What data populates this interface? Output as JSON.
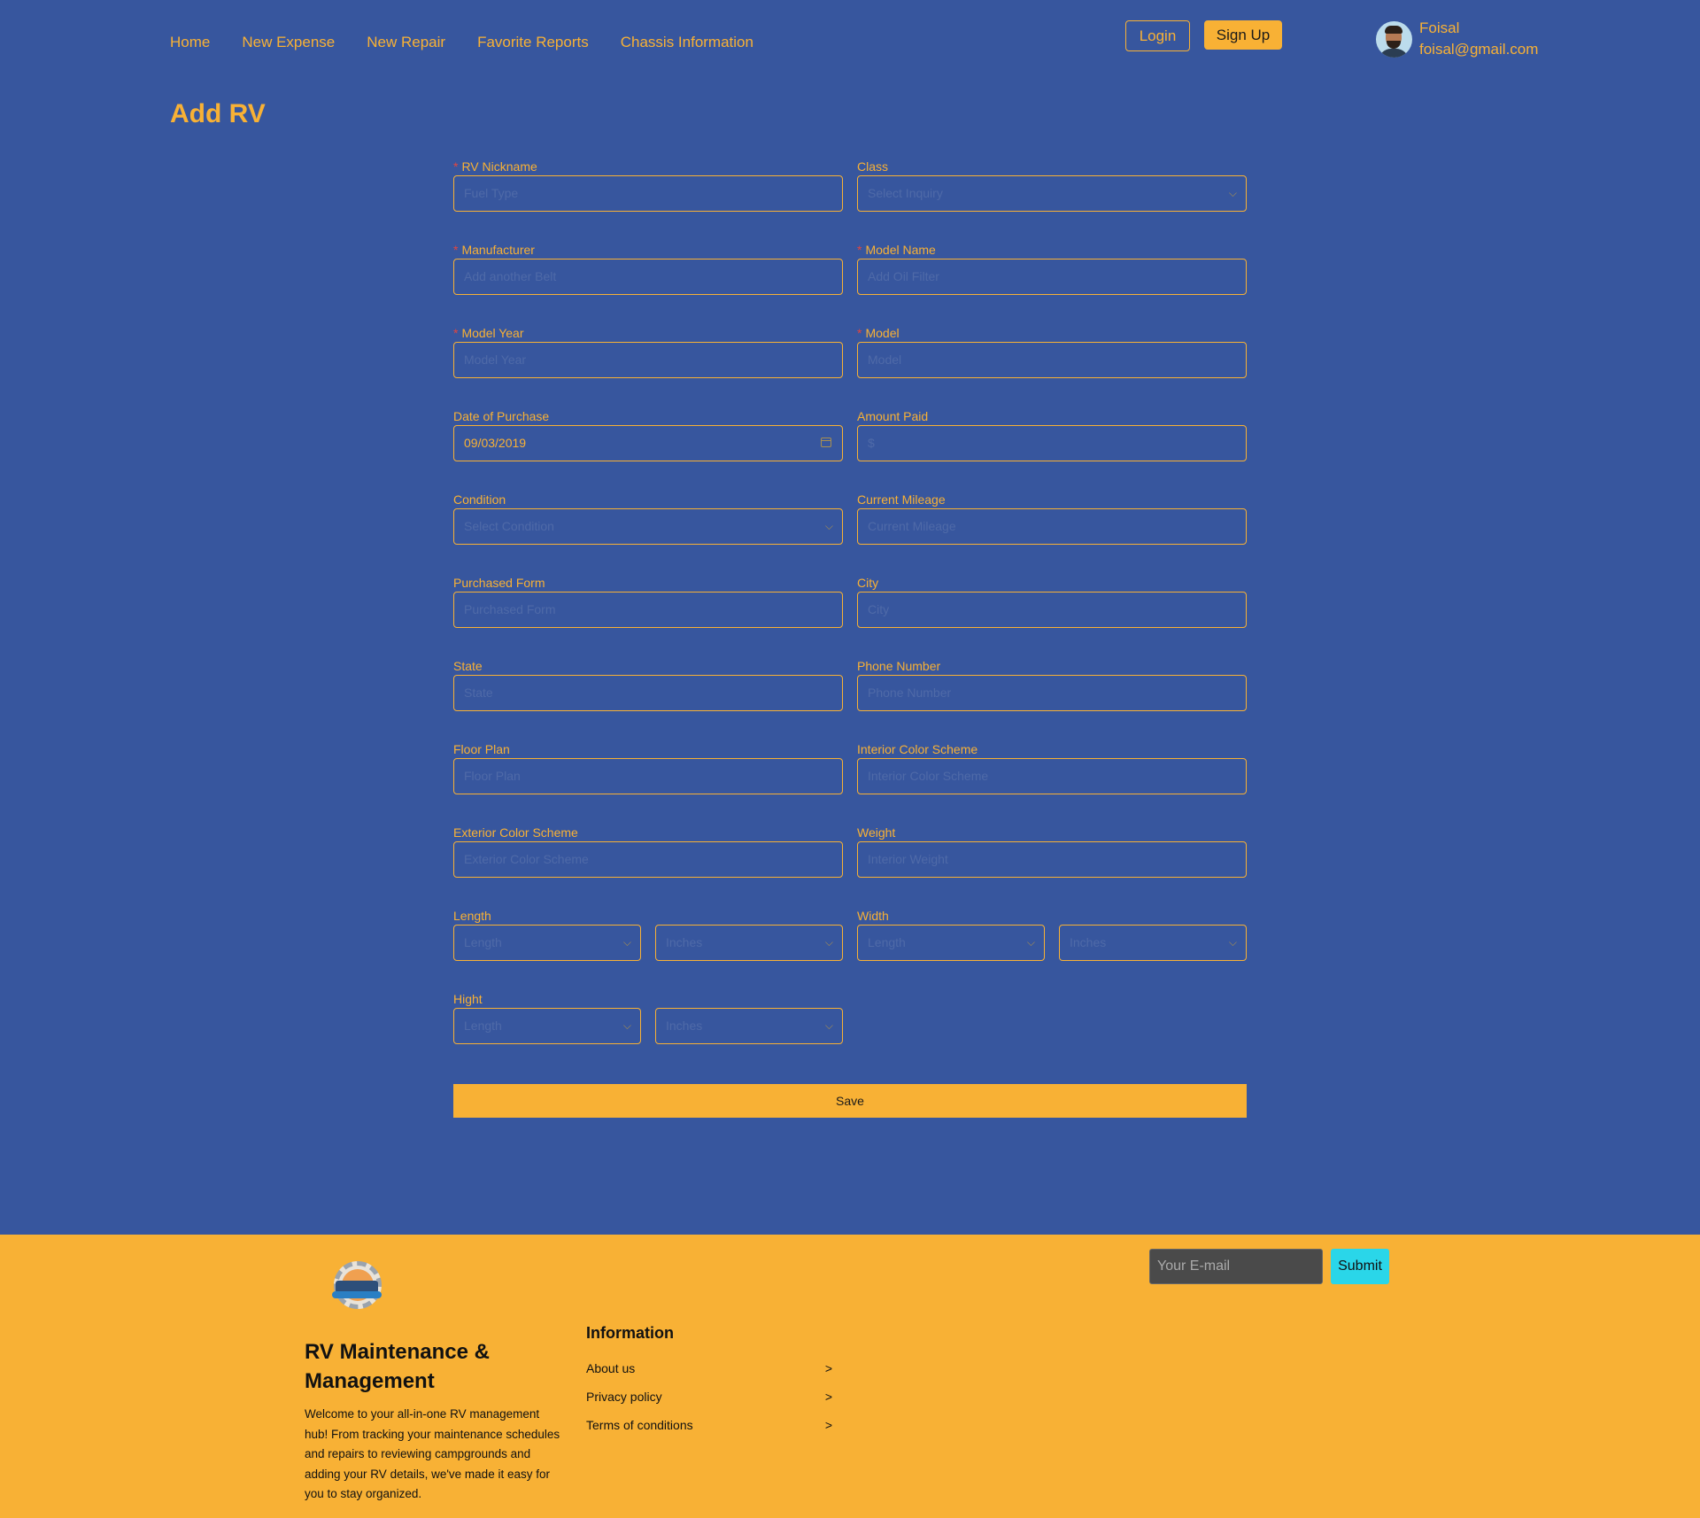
{
  "nav": [
    "Home",
    "New Expense",
    "New Repair",
    "Favorite Reports",
    "Chassis Information"
  ],
  "auth": {
    "login": "Login",
    "signup": "Sign Up"
  },
  "user": {
    "name": "Foisal",
    "email": "foisal@gmail.com"
  },
  "page_title": "Add RV",
  "fields": {
    "rv_nickname": {
      "label": "RV Nickname",
      "required": true,
      "placeholder": "Fuel Type"
    },
    "class": {
      "label": "Class",
      "required": false,
      "placeholder": "Select Inquiry"
    },
    "manufacturer": {
      "label": "Manufacturer",
      "required": true,
      "placeholder": "Add another Belt"
    },
    "model_name": {
      "label": "Model Name",
      "required": true,
      "placeholder": "Add Oil Filter"
    },
    "model_year": {
      "label": "Model Year",
      "required": true,
      "placeholder": "Model Year"
    },
    "model": {
      "label": "Model",
      "required": true,
      "placeholder": "Model"
    },
    "date_of_purchase": {
      "label": "Date of Purchase",
      "value": "09/03/2019"
    },
    "amount_paid": {
      "label": "Amount Paid",
      "placeholder": "$"
    },
    "condition": {
      "label": "Condition",
      "placeholder": "Select Condition"
    },
    "current_mileage": {
      "label": "Current Mileage",
      "placeholder": "Current Mileage"
    },
    "purchased_form": {
      "label": "Purchased Form",
      "placeholder": "Purchased Form"
    },
    "city": {
      "label": "City",
      "placeholder": "City"
    },
    "state": {
      "label": "State",
      "placeholder": "State"
    },
    "phone_number": {
      "label": "Phone Number",
      "placeholder": "Phone Number"
    },
    "floor_plan": {
      "label": "Floor Plan",
      "placeholder": "Floor Plan"
    },
    "interior_color_scheme": {
      "label": "Interior Color Scheme",
      "placeholder": "Interior Color Scheme"
    },
    "exterior_color_scheme": {
      "label": "Exterior Color Scheme",
      "placeholder": "Exterior Color Scheme"
    },
    "weight": {
      "label": "Weight",
      "placeholder": "Interior Weight"
    },
    "length": {
      "label": "Length",
      "value_placeholder": "Length",
      "unit_placeholder": "Inches"
    },
    "width": {
      "label": "Width",
      "value_placeholder": "Length",
      "unit_placeholder": "Inches"
    },
    "hight": {
      "label": "Hight",
      "value_placeholder": "Length",
      "unit_placeholder": "Inches"
    }
  },
  "save_label": "Save",
  "footer": {
    "title": "RV Maintenance & Management",
    "description": "Welcome to your all-in-one RV management hub! From tracking your maintenance schedules and repairs to reviewing campgrounds and adding your RV details, we've made it easy for you to stay organized.",
    "info_title": "Information",
    "info_links": [
      "About us",
      "Privacy policy",
      "Terms of conditions"
    ],
    "arrow": ">",
    "email_placeholder": "Your E-mail",
    "submit_label": "Submit"
  },
  "colors": {
    "background": "#37569e",
    "accent": "#f8b135",
    "required": "#e3453e",
    "submit": "#2ad6e9"
  }
}
